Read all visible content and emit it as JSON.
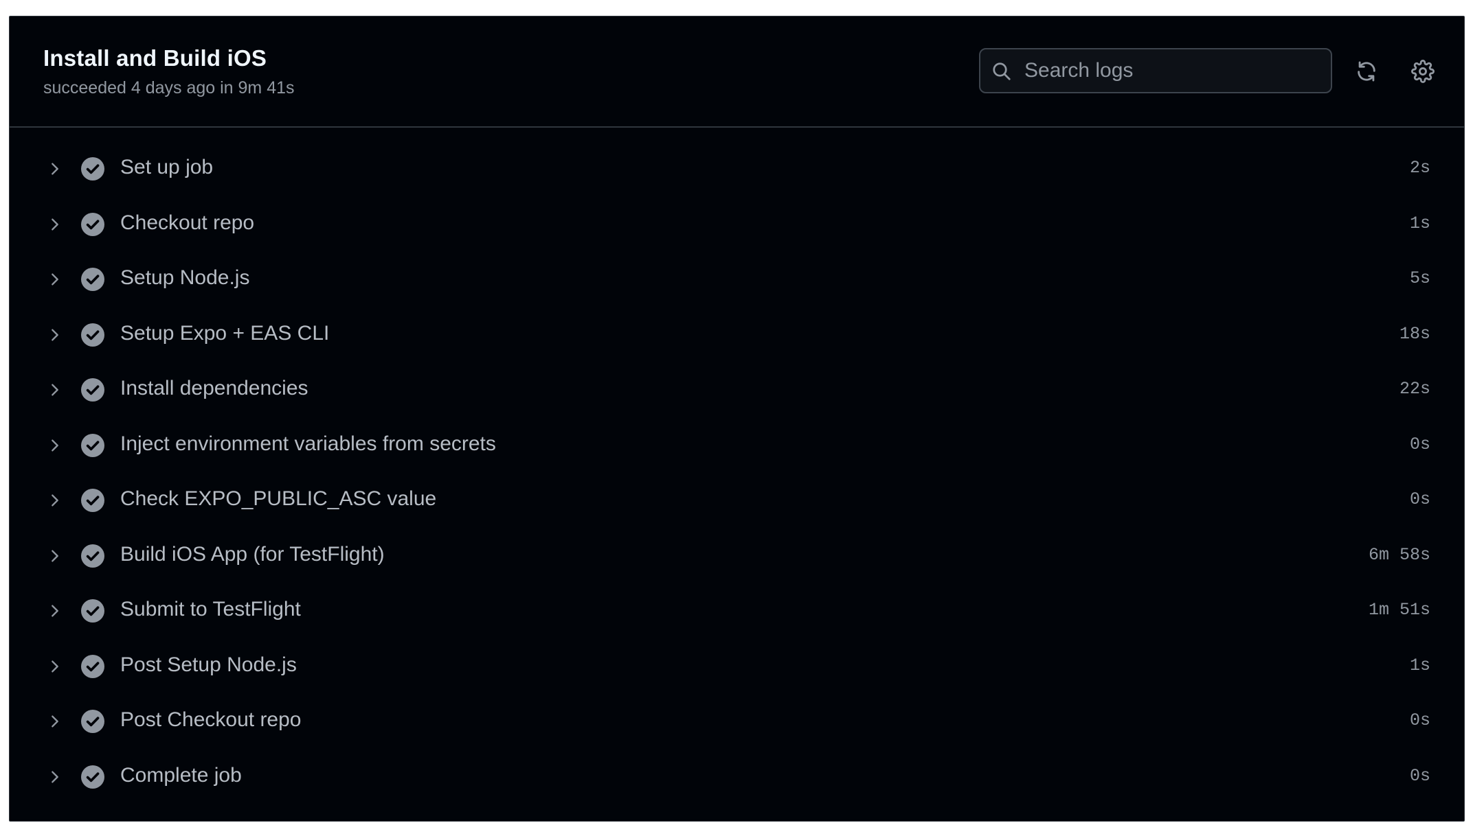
{
  "header": {
    "title": "Install and Build iOS",
    "subtitle": "succeeded 4 days ago in 9m 41s"
  },
  "search": {
    "placeholder": "Search logs",
    "icon": "search-icon"
  },
  "toolbar": {
    "refresh_icon": "refresh-icon",
    "settings_icon": "gear-icon"
  },
  "colors": {
    "background": "#010409",
    "border": "#30363d",
    "title_text": "#f0f6fc",
    "muted_text": "#9198a1",
    "step_text": "#b7bdc5",
    "success_icon": "#9198a1"
  },
  "steps": [
    {
      "name": "Set up job",
      "duration": "2s",
      "status": "success"
    },
    {
      "name": "Checkout repo",
      "duration": "1s",
      "status": "success"
    },
    {
      "name": "Setup Node.js",
      "duration": "5s",
      "status": "success"
    },
    {
      "name": "Setup Expo + EAS CLI",
      "duration": "18s",
      "status": "success"
    },
    {
      "name": "Install dependencies",
      "duration": "22s",
      "status": "success"
    },
    {
      "name": "Inject environment variables from secrets",
      "duration": "0s",
      "status": "success"
    },
    {
      "name": "Check EXPO_PUBLIC_ASC value",
      "duration": "0s",
      "status": "success"
    },
    {
      "name": "Build iOS App (for TestFlight)",
      "duration": "6m 58s",
      "status": "success"
    },
    {
      "name": "Submit to TestFlight",
      "duration": "1m 51s",
      "status": "success"
    },
    {
      "name": "Post Setup Node.js",
      "duration": "1s",
      "status": "success"
    },
    {
      "name": "Post Checkout repo",
      "duration": "0s",
      "status": "success"
    },
    {
      "name": "Complete job",
      "duration": "0s",
      "status": "success"
    }
  ]
}
